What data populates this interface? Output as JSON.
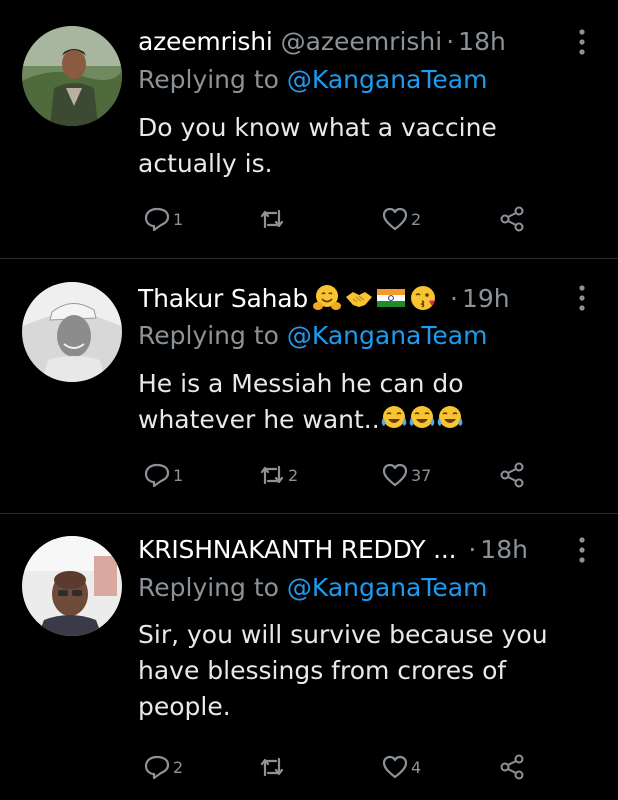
{
  "tweets": [
    {
      "name": "azeemrishi",
      "handle": "@azeemrishi",
      "separator": "·",
      "time": "18h",
      "reply_prefix": "Replying to",
      "reply_mention": "@KanganaTeam",
      "text": "Do you know what a vaccine actually is.",
      "replies": "1",
      "retweets": "",
      "likes": "2",
      "name_emojis": [],
      "text_emojis": []
    },
    {
      "name": "Thakur Sahab",
      "handle": "",
      "separator": "·",
      "time": "19h",
      "reply_prefix": "Replying to",
      "reply_mention": "@KanganaTeam",
      "text": "He is a Messiah he can do whatever he want..",
      "replies": "1",
      "retweets": "2",
      "likes": "37",
      "name_emojis": [
        "hugging-face",
        "handshake",
        "india-flag",
        "kissing-face"
      ],
      "text_emojis": [
        "tears-of-joy",
        "tears-of-joy",
        "tears-of-joy"
      ]
    },
    {
      "name": "KRISHNAKANTH REDDY ...",
      "handle": "",
      "separator": "·",
      "time": "18h",
      "reply_prefix": "Replying to",
      "reply_mention": "@KanganaTeam",
      "text": "Sir, you will survive because you have blessings from crores of people.",
      "replies": "2",
      "retweets": "",
      "likes": "4",
      "name_emojis": [],
      "text_emojis": []
    }
  ],
  "colors": {
    "background": "#000000",
    "text": "#e7e9ea",
    "muted": "#8b9298",
    "mention": "#1d9bf0",
    "divider": "#2a2d31"
  },
  "icons": [
    "reply-icon",
    "retweet-icon",
    "like-icon",
    "share-icon",
    "more-icon"
  ]
}
